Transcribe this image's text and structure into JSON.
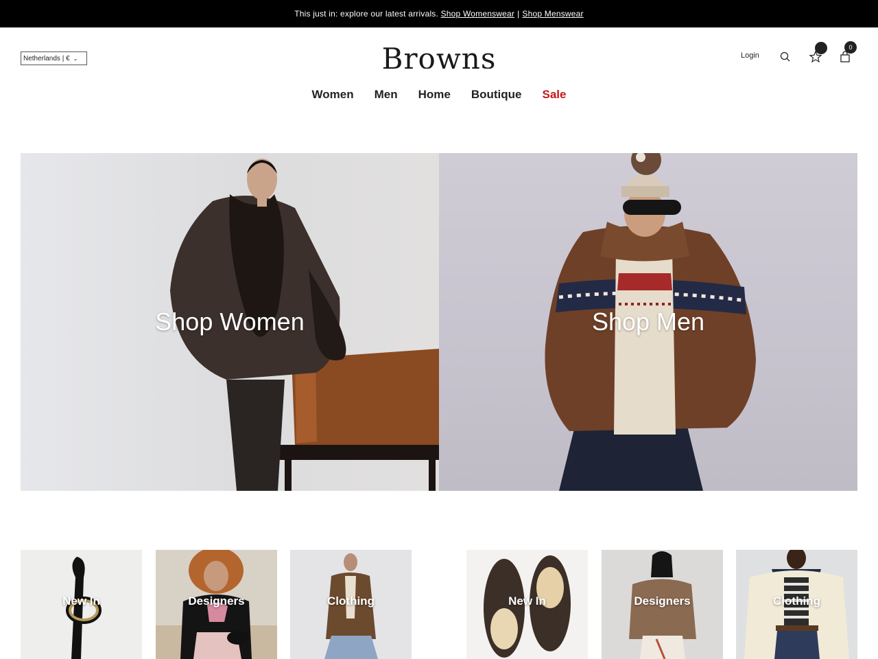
{
  "announcement": {
    "text": "This just in: explore our latest arrivals.",
    "link_women": "Shop Womenswear",
    "separator": "|",
    "link_men": "Shop Menswear"
  },
  "header": {
    "region": "Netherlands | €",
    "logo": "Browns",
    "login": "Login",
    "bag_count": "0"
  },
  "nav": {
    "items": [
      "Women",
      "Men",
      "Home",
      "Boutique",
      "Sale"
    ],
    "sale_color": "#c4161c"
  },
  "hero": {
    "women_label": "Shop Women",
    "men_label": "Shop Men"
  },
  "tiles": {
    "women": [
      "New In",
      "Designers",
      "Clothing"
    ],
    "men": [
      "New In",
      "Designers",
      "Clothing"
    ]
  },
  "icons": [
    "search-icon",
    "star-icon",
    "bag-icon",
    "chevron-down-icon"
  ]
}
